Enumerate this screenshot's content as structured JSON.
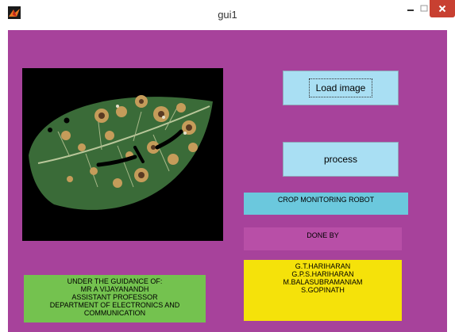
{
  "window": {
    "title": "gui1"
  },
  "buttons": {
    "load_image": "Load image",
    "process": "process"
  },
  "panels": {
    "crop_title": "CROP MONITORING ROBOT",
    "done_by": "DONE BY",
    "names": [
      "G.T.HARIHARAN",
      "G.P.S.HARIHARAN",
      "M.BALASUBRAMANIAM",
      "S.GOPINATH"
    ],
    "guidance": [
      "UNDER THE GUIDANCE OF:",
      "MR A VIJAYANANDH",
      "ASSISTANT PROFESSOR",
      "DEPARTMENT OF ELECTRONICS AND",
      "COMMUNICATION"
    ]
  },
  "colors": {
    "background": "#a7429b",
    "button": "#a9dff3",
    "crop_title": "#6bc8dd",
    "done_by": "#b84fa7",
    "names": "#f5e20a",
    "guidance": "#74c24f",
    "close": "#c84031"
  },
  "icons": {
    "app": "matlab-icon",
    "minimize": "minimize-icon",
    "maximize": "maximize-icon",
    "close": "close-icon"
  }
}
